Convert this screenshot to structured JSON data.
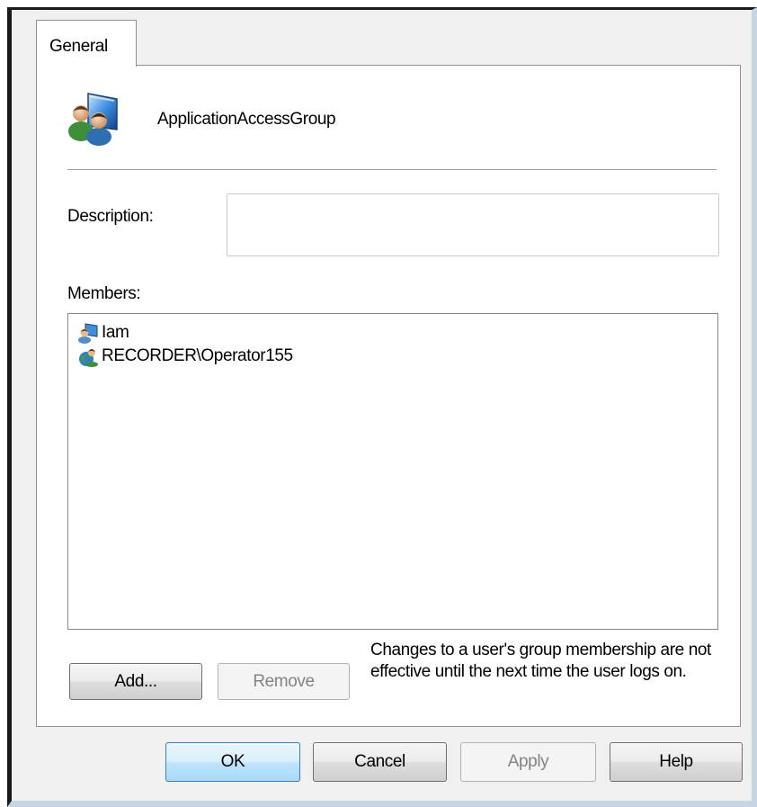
{
  "tabs": [
    {
      "label": "General",
      "active": true
    }
  ],
  "group": {
    "name": "ApplicationAccessGroup",
    "icon": "user-group-icon"
  },
  "description": {
    "label": "Description:",
    "value": "",
    "placeholder": ""
  },
  "members": {
    "label": "Members:",
    "items": [
      {
        "name": "Iam",
        "icon": "user-computer-icon"
      },
      {
        "name": "RECORDER\\Operator155",
        "icon": "domain-user-icon"
      }
    ]
  },
  "buttons": {
    "add": "Add...",
    "remove": "Remove",
    "ok": "OK",
    "cancel": "Cancel",
    "apply": "Apply",
    "help": "Help"
  },
  "note": "Changes to a user's group membership are not effective until the next time the user logs on.",
  "colors": {
    "window_bg": "#f0f0f0",
    "panel_bg": "#ffffff",
    "default_button_border": "#3c7fb1",
    "disabled_text": "#838383"
  }
}
